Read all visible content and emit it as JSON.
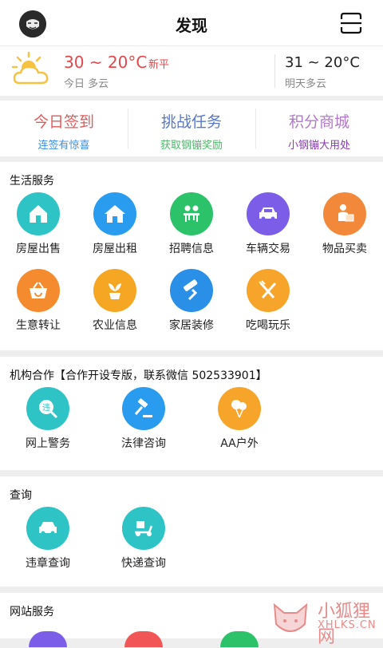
{
  "header": {
    "title": "发现"
  },
  "weather": {
    "today_temp": "30 ~ 20°C",
    "today_tag": "新平",
    "today_desc": "今日 多云",
    "tomorrow_temp": "31 ~ 20°C",
    "tomorrow_desc": "明天多云"
  },
  "actions": [
    {
      "title": "今日签到",
      "sub": "连签有惊喜",
      "title_color": "#e05a5a",
      "sub_color": "#3a8ee6"
    },
    {
      "title": "挑战任务",
      "sub": "获取钢镚奖励",
      "title_color": "#5a78c8",
      "sub_color": "#4cb86a"
    },
    {
      "title": "积分商城",
      "sub": "小钢镚大用处",
      "title_color": "#b07ac8",
      "sub_color": "#8a3ab8"
    }
  ],
  "life": {
    "title": "生活服务",
    "items": [
      {
        "label": "房屋出售",
        "icon": "house-icon",
        "color": "#2ec3c5"
      },
      {
        "label": "房屋出租",
        "icon": "home-icon",
        "color": "#2a9cf0"
      },
      {
        "label": "招聘信息",
        "icon": "recruit-icon",
        "color": "#2bc26a"
      },
      {
        "label": "车辆交易",
        "icon": "car-icon",
        "color": "#7b5de8"
      },
      {
        "label": "物品买卖",
        "icon": "person-box-icon",
        "color": "#f2893a"
      },
      {
        "label": "生意转让",
        "icon": "basket-icon",
        "color": "#f58b2f"
      },
      {
        "label": "农业信息",
        "icon": "plant-icon",
        "color": "#f5a623"
      },
      {
        "label": "家居装修",
        "icon": "roller-icon",
        "color": "#2a8fe6"
      },
      {
        "label": "吃喝玩乐",
        "icon": "fork-knife-icon",
        "color": "#f7a42a"
      }
    ]
  },
  "org": {
    "title": "机构合作【合作开设专版，联系微信 502533901】",
    "items": [
      {
        "label": "网上警务",
        "icon": "violation-icon",
        "color": "#2ec3c5"
      },
      {
        "label": "法律咨询",
        "icon": "gavel-icon",
        "color": "#2a9cf0"
      },
      {
        "label": "AA户外",
        "icon": "balloon-icon",
        "color": "#f7a42a"
      }
    ]
  },
  "query": {
    "title": "查询",
    "items": [
      {
        "label": "违章查询",
        "icon": "car-icon",
        "color": "#2ec3c5"
      },
      {
        "label": "快递查询",
        "icon": "scooter-icon",
        "color": "#2ec3c5"
      }
    ]
  },
  "site": {
    "title": "网站服务"
  },
  "watermark": {
    "text": "小狐狸网",
    "sub": "XHLKS.CN"
  }
}
